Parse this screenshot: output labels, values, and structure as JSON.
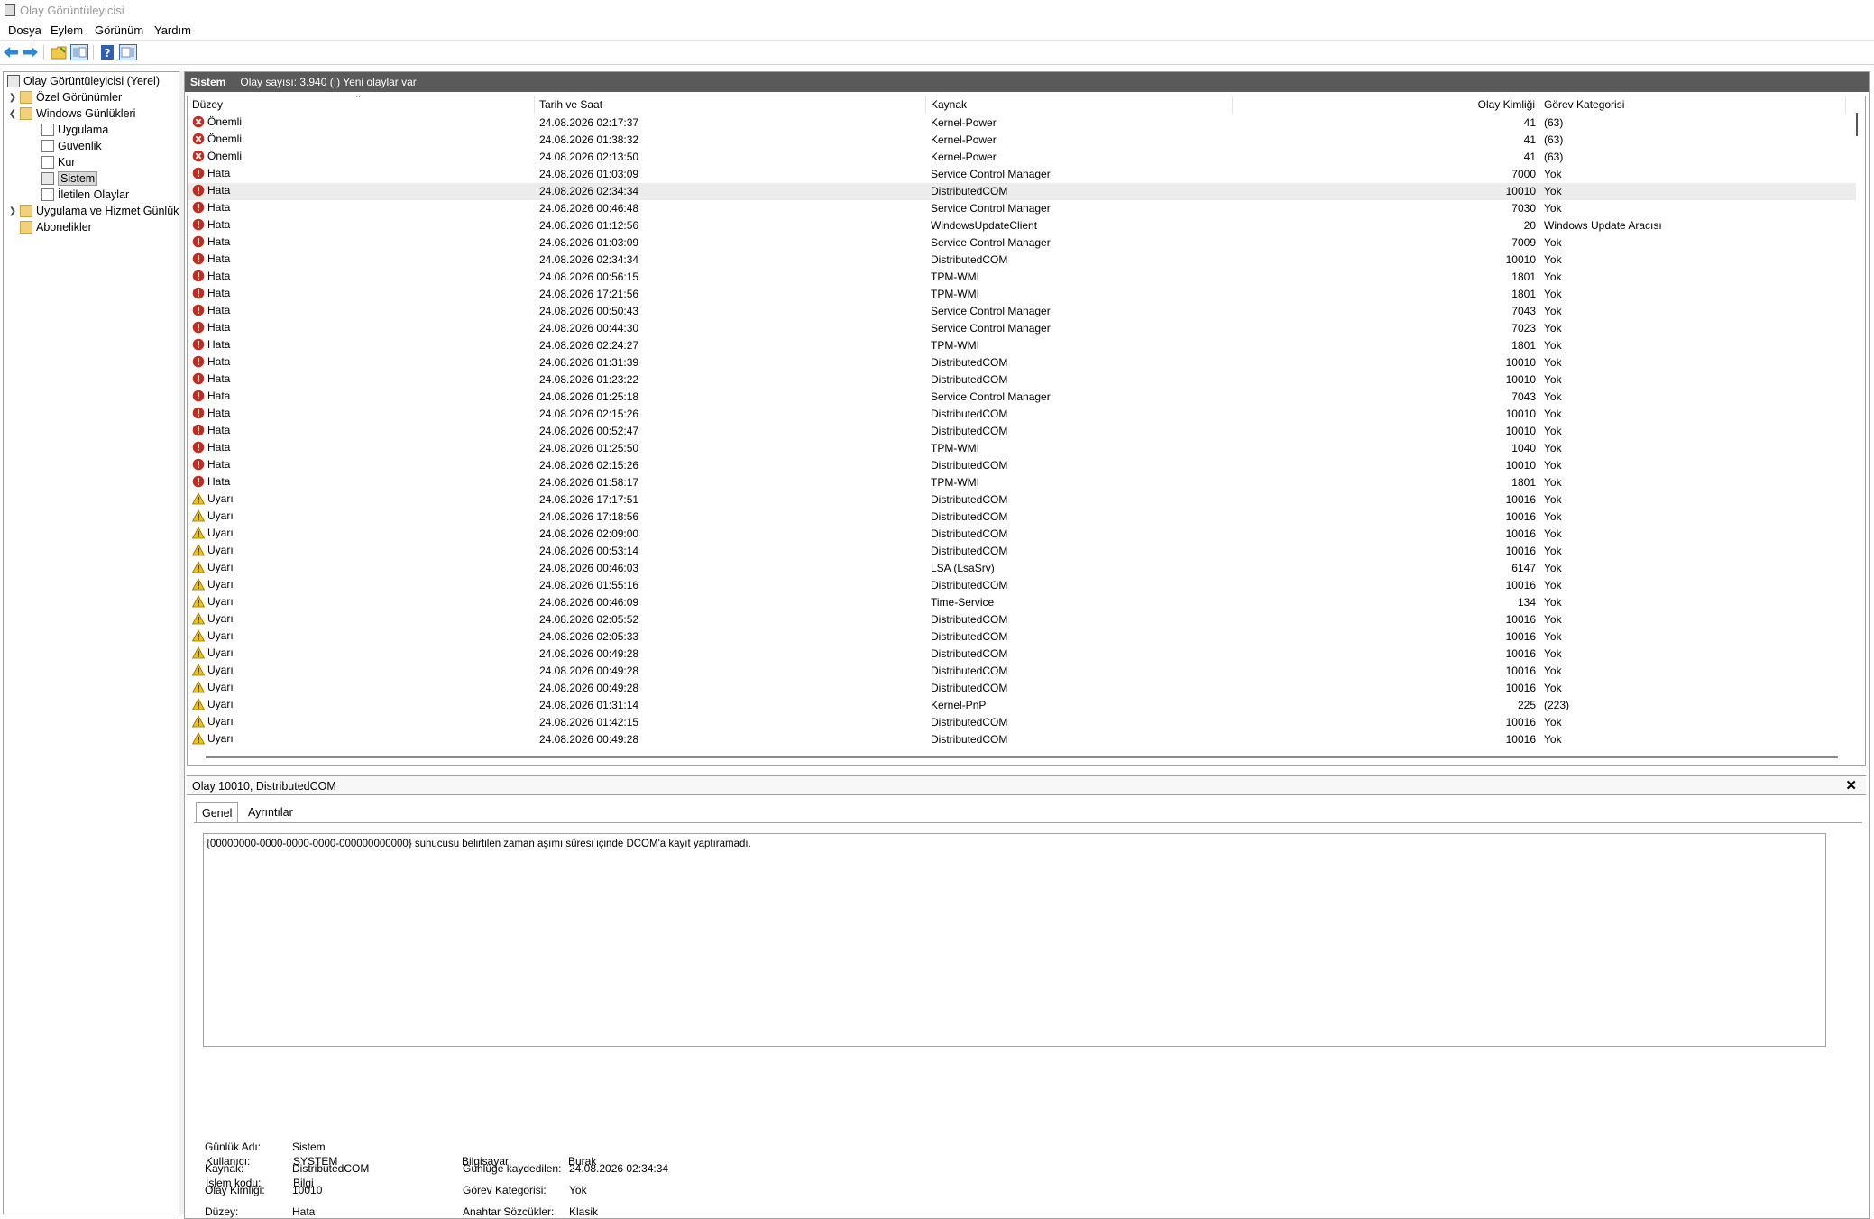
{
  "window": {
    "title": "Olay Görüntüleyicisi"
  },
  "menu": [
    "Dosya",
    "Eylem",
    "Görünüm",
    "Yardım"
  ],
  "toolbar": {
    "icons": [
      "back-arrow-icon",
      "forward-arrow-icon",
      "open-folder-icon",
      "console-tree-icon",
      "help-icon",
      "action-pane-icon"
    ]
  },
  "tree": {
    "root": "Olay Görüntüleyicisi (Yerel)",
    "custom_views": "Özel Görünümler",
    "windows_logs": "Windows Günlükleri",
    "logs": [
      "Uygulama",
      "Güvenlik",
      "Kur",
      "Sistem",
      "İletilen Olaylar"
    ],
    "app_services": "Uygulama ve Hizmet Günlük",
    "subscriptions": "Abonelikler"
  },
  "header": {
    "name": "Sistem",
    "info": "Olay sayısı: 3.940 (!) Yeni olaylar var"
  },
  "columns": {
    "level": "Düzey",
    "datetime": "Tarih ve Saat",
    "source": "Kaynak",
    "event_id": "Olay Kimliği",
    "category": "Görev Kategorisi"
  },
  "colors": {
    "critical": "#c42b1c",
    "error": "#c42b1c",
    "warning": "#f5c400",
    "header_bar": "#5a5a5a"
  },
  "events": [
    {
      "level": "Önemli",
      "type": "critical",
      "datetime": "24.08.2026 02:17:37",
      "source": "Kernel-Power",
      "id": "41",
      "category": "(63)"
    },
    {
      "level": "Önemli",
      "type": "critical",
      "datetime": "24.08.2026 01:38:32",
      "source": "Kernel-Power",
      "id": "41",
      "category": "(63)"
    },
    {
      "level": "Önemli",
      "type": "critical",
      "datetime": "24.08.2026 02:13:50",
      "source": "Kernel-Power",
      "id": "41",
      "category": "(63)"
    },
    {
      "level": "Hata",
      "type": "error",
      "datetime": "24.08.2026 01:03:09",
      "source": "Service Control Manager",
      "id": "7000",
      "category": "Yok"
    },
    {
      "level": "Hata",
      "type": "error",
      "datetime": "24.08.2026 02:34:34",
      "source": "DistributedCOM",
      "id": "10010",
      "category": "Yok",
      "selected": true
    },
    {
      "level": "Hata",
      "type": "error",
      "datetime": "24.08.2026 00:46:48",
      "source": "Service Control Manager",
      "id": "7030",
      "category": "Yok"
    },
    {
      "level": "Hata",
      "type": "error",
      "datetime": "24.08.2026 01:12:56",
      "source": "WindowsUpdateClient",
      "id": "20",
      "category": "Windows Update Aracısı"
    },
    {
      "level": "Hata",
      "type": "error",
      "datetime": "24.08.2026 01:03:09",
      "source": "Service Control Manager",
      "id": "7009",
      "category": "Yok"
    },
    {
      "level": "Hata",
      "type": "error",
      "datetime": "24.08.2026 02:34:34",
      "source": "DistributedCOM",
      "id": "10010",
      "category": "Yok"
    },
    {
      "level": "Hata",
      "type": "error",
      "datetime": "24.08.2026 00:56:15",
      "source": "TPM-WMI",
      "id": "1801",
      "category": "Yok"
    },
    {
      "level": "Hata",
      "type": "error",
      "datetime": "24.08.2026 17:21:56",
      "source": "TPM-WMI",
      "id": "1801",
      "category": "Yok"
    },
    {
      "level": "Hata",
      "type": "error",
      "datetime": "24.08.2026 00:50:43",
      "source": "Service Control Manager",
      "id": "7043",
      "category": "Yok"
    },
    {
      "level": "Hata",
      "type": "error",
      "datetime": "24.08.2026 00:44:30",
      "source": "Service Control Manager",
      "id": "7023",
      "category": "Yok"
    },
    {
      "level": "Hata",
      "type": "error",
      "datetime": "24.08.2026 02:24:27",
      "source": "TPM-WMI",
      "id": "1801",
      "category": "Yok"
    },
    {
      "level": "Hata",
      "type": "error",
      "datetime": "24.08.2026 01:31:39",
      "source": "DistributedCOM",
      "id": "10010",
      "category": "Yok"
    },
    {
      "level": "Hata",
      "type": "error",
      "datetime": "24.08.2026 01:23:22",
      "source": "DistributedCOM",
      "id": "10010",
      "category": "Yok"
    },
    {
      "level": "Hata",
      "type": "error",
      "datetime": "24.08.2026 01:25:18",
      "source": "Service Control Manager",
      "id": "7043",
      "category": "Yok"
    },
    {
      "level": "Hata",
      "type": "error",
      "datetime": "24.08.2026 02:15:26",
      "source": "DistributedCOM",
      "id": "10010",
      "category": "Yok"
    },
    {
      "level": "Hata",
      "type": "error",
      "datetime": "24.08.2026 00:52:47",
      "source": "DistributedCOM",
      "id": "10010",
      "category": "Yok"
    },
    {
      "level": "Hata",
      "type": "error",
      "datetime": "24.08.2026 01:25:50",
      "source": "TPM-WMI",
      "id": "1040",
      "category": "Yok"
    },
    {
      "level": "Hata",
      "type": "error",
      "datetime": "24.08.2026 02:15:26",
      "source": "DistributedCOM",
      "id": "10010",
      "category": "Yok"
    },
    {
      "level": "Hata",
      "type": "error",
      "datetime": "24.08.2026 01:58:17",
      "source": "TPM-WMI",
      "id": "1801",
      "category": "Yok"
    },
    {
      "level": "Uyarı",
      "type": "warning",
      "datetime": "24.08.2026 17:17:51",
      "source": "DistributedCOM",
      "id": "10016",
      "category": "Yok"
    },
    {
      "level": "Uyarı",
      "type": "warning",
      "datetime": "24.08.2026 17:18:56",
      "source": "DistributedCOM",
      "id": "10016",
      "category": "Yok"
    },
    {
      "level": "Uyarı",
      "type": "warning",
      "datetime": "24.08.2026 02:09:00",
      "source": "DistributedCOM",
      "id": "10016",
      "category": "Yok"
    },
    {
      "level": "Uyarı",
      "type": "warning",
      "datetime": "24.08.2026 00:53:14",
      "source": "DistributedCOM",
      "id": "10016",
      "category": "Yok"
    },
    {
      "level": "Uyarı",
      "type": "warning",
      "datetime": "24.08.2026 00:46:03",
      "source": "LSA (LsaSrv)",
      "id": "6147",
      "category": "Yok"
    },
    {
      "level": "Uyarı",
      "type": "warning",
      "datetime": "24.08.2026 01:55:16",
      "source": "DistributedCOM",
      "id": "10016",
      "category": "Yok"
    },
    {
      "level": "Uyarı",
      "type": "warning",
      "datetime": "24.08.2026 00:46:09",
      "source": "Time-Service",
      "id": "134",
      "category": "Yok"
    },
    {
      "level": "Uyarı",
      "type": "warning",
      "datetime": "24.08.2026 02:05:52",
      "source": "DistributedCOM",
      "id": "10016",
      "category": "Yok"
    },
    {
      "level": "Uyarı",
      "type": "warning",
      "datetime": "24.08.2026 02:05:33",
      "source": "DistributedCOM",
      "id": "10016",
      "category": "Yok"
    },
    {
      "level": "Uyarı",
      "type": "warning",
      "datetime": "24.08.2026 00:49:28",
      "source": "DistributedCOM",
      "id": "10016",
      "category": "Yok"
    },
    {
      "level": "Uyarı",
      "type": "warning",
      "datetime": "24.08.2026 00:49:28",
      "source": "DistributedCOM",
      "id": "10016",
      "category": "Yok"
    },
    {
      "level": "Uyarı",
      "type": "warning",
      "datetime": "24.08.2026 00:49:28",
      "source": "DistributedCOM",
      "id": "10016",
      "category": "Yok"
    },
    {
      "level": "Uyarı",
      "type": "warning",
      "datetime": "24.08.2026 01:31:14",
      "source": "Kernel-PnP",
      "id": "225",
      "category": "(223)"
    },
    {
      "level": "Uyarı",
      "type": "warning",
      "datetime": "24.08.2026 01:42:15",
      "source": "DistributedCOM",
      "id": "10016",
      "category": "Yok"
    },
    {
      "level": "Uyarı",
      "type": "warning",
      "datetime": "24.08.2026 00:49:28",
      "source": "DistributedCOM",
      "id": "10016",
      "category": "Yok"
    }
  ],
  "detail": {
    "title": "Olay 10010, DistributedCOM",
    "close": "✕",
    "tabs": [
      "Genel",
      "Ayrıntılar"
    ],
    "message": "{00000000-0000-0000-0000-000000000000} sunucusu belirtilen zaman aşımı süresi içinde DCOM'a kayıt yaptıramadı.",
    "props": {
      "log_name_label": "Günlük Adı:",
      "log_name": "Sistem",
      "source_label": "Kaynak:",
      "source": "DistributedCOM",
      "logged_label": "Günlüğe kaydedilen:",
      "logged": "24.08.2026 02:34:34",
      "event_id_label": "Olay Kimliği:",
      "event_id": "10010",
      "task_label": "Görev Kategorisi:",
      "task": "Yok",
      "level_label": "Düzey:",
      "level": "Hata",
      "keywords_label": "Anahtar Sözcükler:",
      "keywords": "Klasik",
      "user_label": "Kullanıcı:",
      "user": "SYSTEM",
      "computer_label": "Bilgisayar:",
      "computer": "Burak",
      "opcode_label": "İşlem kodu:",
      "opcode": "Bilgi"
    }
  }
}
